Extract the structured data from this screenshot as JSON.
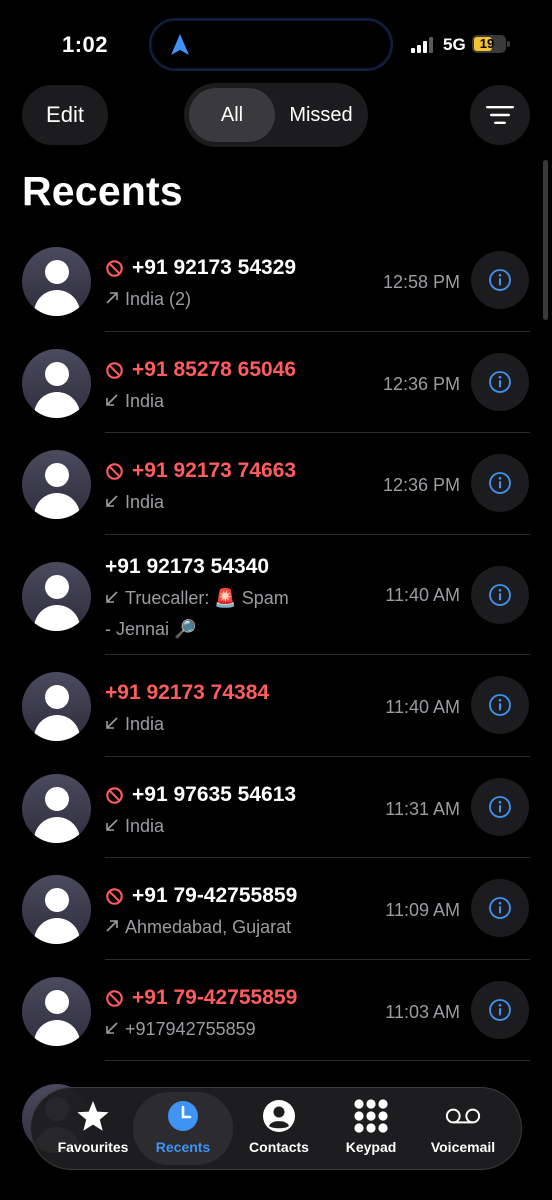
{
  "status_bar": {
    "time": "1:02",
    "network": "5G",
    "battery": "19"
  },
  "header": {
    "edit_label": "Edit",
    "segments": [
      "All",
      "Missed"
    ],
    "selected_segment": "All",
    "title": "Recents"
  },
  "calls": [
    {
      "number": "+91 92173 54329",
      "blocked": true,
      "missed": false,
      "direction": "outgoing",
      "detail": "India (2)",
      "time": "12:58 PM"
    },
    {
      "number": "+91 85278 65046",
      "blocked": true,
      "missed": true,
      "direction": "incoming",
      "detail": "India",
      "time": "12:36 PM"
    },
    {
      "number": "+91 92173 74663",
      "blocked": true,
      "missed": true,
      "direction": "incoming",
      "detail": "India",
      "time": "12:36 PM"
    },
    {
      "number": "+91 92173 54340",
      "blocked": false,
      "missed": false,
      "direction": "incoming",
      "detail": "Truecaller: 🚨 Spam",
      "detail2": "- Jennai 🔎",
      "time": "11:40 AM"
    },
    {
      "number": "+91 92173 74384",
      "blocked": false,
      "missed": true,
      "direction": "incoming",
      "detail": "India",
      "time": "11:40 AM"
    },
    {
      "number": "+91 97635 54613",
      "blocked": true,
      "missed": false,
      "direction": "incoming",
      "detail": "India",
      "time": "11:31 AM"
    },
    {
      "number": "+91 79-42755859",
      "blocked": true,
      "missed": false,
      "direction": "outgoing",
      "detail": "Ahmedabad, Gujarat",
      "time": "11:09 AM"
    },
    {
      "number": "+91 79-42755859",
      "blocked": true,
      "missed": true,
      "direction": "incoming",
      "detail": "+917942755859",
      "time": "11:03 AM"
    }
  ],
  "tabs": [
    {
      "label": "Favourites",
      "icon": "star-icon",
      "active": false
    },
    {
      "label": "Recents",
      "icon": "clock-icon",
      "active": true
    },
    {
      "label": "Contacts",
      "icon": "person-circle-icon",
      "active": false
    },
    {
      "label": "Keypad",
      "icon": "keypad-icon",
      "active": false
    },
    {
      "label": "Voicemail",
      "icon": "voicemail-icon",
      "active": false
    }
  ],
  "colors": {
    "missed": "#fe5c5e",
    "accent": "#3e93f5",
    "secondary_text": "#9c9ca2",
    "battery_low": "#f4c331"
  }
}
